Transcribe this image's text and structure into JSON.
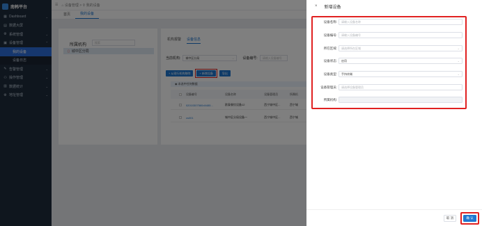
{
  "sidebar": {
    "brand": "南韩平台",
    "items": [
      {
        "icon": "▦",
        "label": "Dashboard",
        "arrow": "⌄",
        "cls": ""
      },
      {
        "icon": "▤",
        "label": "数据大屏",
        "arrow": "",
        "cls": ""
      },
      {
        "icon": "⚙",
        "label": "系统管理",
        "arrow": "⌄",
        "cls": ""
      },
      {
        "icon": "▣",
        "label": "设备管理",
        "arrow": "⌃",
        "cls": ""
      },
      {
        "icon": "",
        "label": "我的设备",
        "arrow": "",
        "cls": "sub active"
      },
      {
        "icon": "",
        "label": "设备日志",
        "arrow": "",
        "cls": "sub"
      },
      {
        "icon": "✎",
        "label": "告警管理",
        "arrow": "⌄",
        "cls": ""
      },
      {
        "icon": "⚇",
        "label": "操作管理",
        "arrow": "⌄",
        "cls": ""
      },
      {
        "icon": "▥",
        "label": "数据统计",
        "arrow": "⌄",
        "cls": ""
      },
      {
        "icon": "⚙",
        "label": "地址管理",
        "arrow": "⌄",
        "cls": ""
      }
    ]
  },
  "topbar": {
    "icon": "☰",
    "breadcrumb": "⌂ 设备管理 > ⚲ 我的设备"
  },
  "tabs": [
    {
      "label": "首页",
      "on": false
    },
    {
      "label": "我的设备",
      "on": true
    }
  ],
  "left_panel": {
    "title": "所属机构",
    "search_placeholder": "搜索",
    "tree_item": "城中区分局"
  },
  "right_panel": {
    "tabs": [
      {
        "label": "机构报警",
        "on": false
      },
      {
        "label": "设备信息",
        "on": true
      }
    ],
    "org_label": "当前机构:",
    "org_value": "城中区分局",
    "code_label": "设备编号:",
    "code_placeholder": "请输入设备编号",
    "btn_move": "+ 从现行机构移除",
    "btn_add": "+ 新增设备",
    "btn_export": "导出",
    "note": "◉ 本选中任何数据",
    "columns": [
      "设备编号",
      "设备名称",
      "设备管理员",
      "所属机"
    ],
    "rows": [
      [
        "02010307560d4485...",
        "欧泰餐饮设备12",
        "西宁城中区...",
        "西宁城"
      ],
      [
        "cs001",
        "城中区分局设备一",
        "西宁城中区...",
        "西宁城"
      ]
    ]
  },
  "drawer": {
    "close": "×",
    "title": "新增设备",
    "form": [
      {
        "label": "设备名称:",
        "text": "请输入设备名称",
        "kind": "ph"
      },
      {
        "label": "设备编号:",
        "text": "请输入设备编号",
        "kind": "ph"
      },
      {
        "label": "所在区域:",
        "text": "请选择所在区域",
        "kind": "ph-sel"
      },
      {
        "label": "设备状态:",
        "text": "启用",
        "kind": "val-sel"
      },
      {
        "label": "设备类型:",
        "text": "手持终端",
        "kind": "val-sel"
      },
      {
        "label": "设备管理员:",
        "text": "请选择设备管理员",
        "kind": "ph"
      },
      {
        "label": "所属机构:",
        "text": "",
        "kind": "dis"
      }
    ],
    "cancel": "取 消",
    "confirm": "确 认"
  }
}
